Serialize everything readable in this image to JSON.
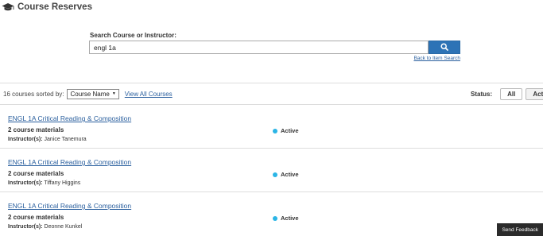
{
  "header": {
    "title": "Course Reserves",
    "icon": "graduation-cap-icon"
  },
  "search": {
    "label": "Search Course or Instructor:",
    "value": "engl 1a",
    "button_icon": "search-icon",
    "back_link": "Back to Item Search"
  },
  "results": {
    "count_text": "16 courses sorted by:",
    "sort_value": "Course Name",
    "view_all": "View All Courses"
  },
  "status_filter": {
    "label": "Status:",
    "all": "All",
    "active": "Active"
  },
  "courses": [
    {
      "title": "ENGL 1A Critical Reading & Composition",
      "materials": "2 course materials",
      "instructor_label": "Instructor(s):",
      "instructor": "Janice Tanemura",
      "status": "Active"
    },
    {
      "title": "ENGL 1A Critical Reading & Composition",
      "materials": "2 course materials",
      "instructor_label": "Instructor(s):",
      "instructor": "Tiffany Higgins",
      "status": "Active"
    },
    {
      "title": "ENGL 1A Critical Reading & Composition",
      "materials": "2 course materials",
      "instructor_label": "Instructor(s):",
      "instructor": "Deonne Kunkel",
      "status": "Active"
    }
  ],
  "feedback": {
    "label": "Send Feedback"
  },
  "colors": {
    "accent": "#2d73b6",
    "link": "#2a5f9e",
    "status_dot": "#2bb5e6"
  }
}
